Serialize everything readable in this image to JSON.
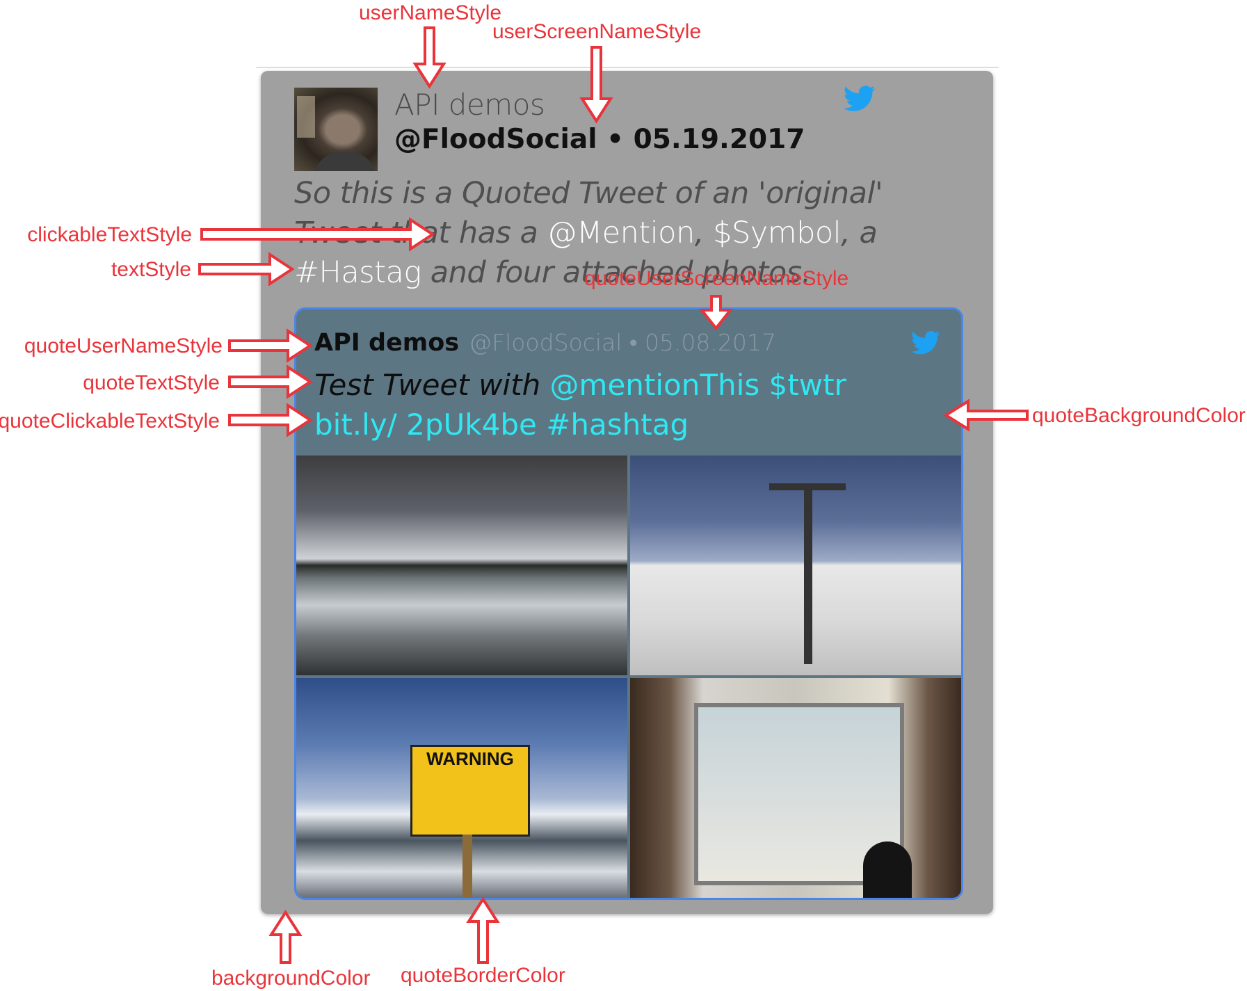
{
  "annotations": {
    "userNameStyle": "userNameStyle",
    "userScreenNameStyle": "userScreenNameStyle",
    "clickableTextStyle": "clickableTextStyle",
    "textStyle": "textStyle",
    "quoteUserScreenNameStyle": "quoteUserScreenNameStyle",
    "quoteUserNameStyle": "quoteUserNameStyle",
    "quoteTextStyle": "quoteTextStyle",
    "quoteClickableTextStyle": "quoteClickableTextStyle",
    "quoteBackgroundColor": "quoteBackgroundColor",
    "backgroundColor": "backgroundColor",
    "quoteBorderColor": "quoteBorderColor"
  },
  "tweet": {
    "user_name": "API demos",
    "screen_name_line": "@FloodSocial • 05.19.2017",
    "text": {
      "part1": "So this is a Quoted Tweet of an 'original' Tweet that has a ",
      "mention": "@Mention",
      "sep1": ",  ",
      "symbol": "$Symbol",
      "sep2": ", a ",
      "hashtag": "#Hastag",
      "part2": " and four attached photos."
    }
  },
  "quote": {
    "user_name": "API demos",
    "screen_name_line": "@FloodSocial  • 05.08.2017",
    "text": {
      "part1": "Test Tweet with ",
      "links": "@mentionThis $twtr bit.ly/ 2pUk4be #hashtag"
    },
    "photos": {
      "sign_title": "WARNING"
    }
  },
  "colors": {
    "annotation": "#e8343a",
    "card_background": "#a0a0a0",
    "quote_background": "#5d7684",
    "quote_border": "#4a86e8",
    "quote_link": "#2ee8f2",
    "twitter_blue": "#1da1f2"
  },
  "icons": {
    "tweet": "twitter-bird-icon",
    "quote": "twitter-bird-icon"
  }
}
